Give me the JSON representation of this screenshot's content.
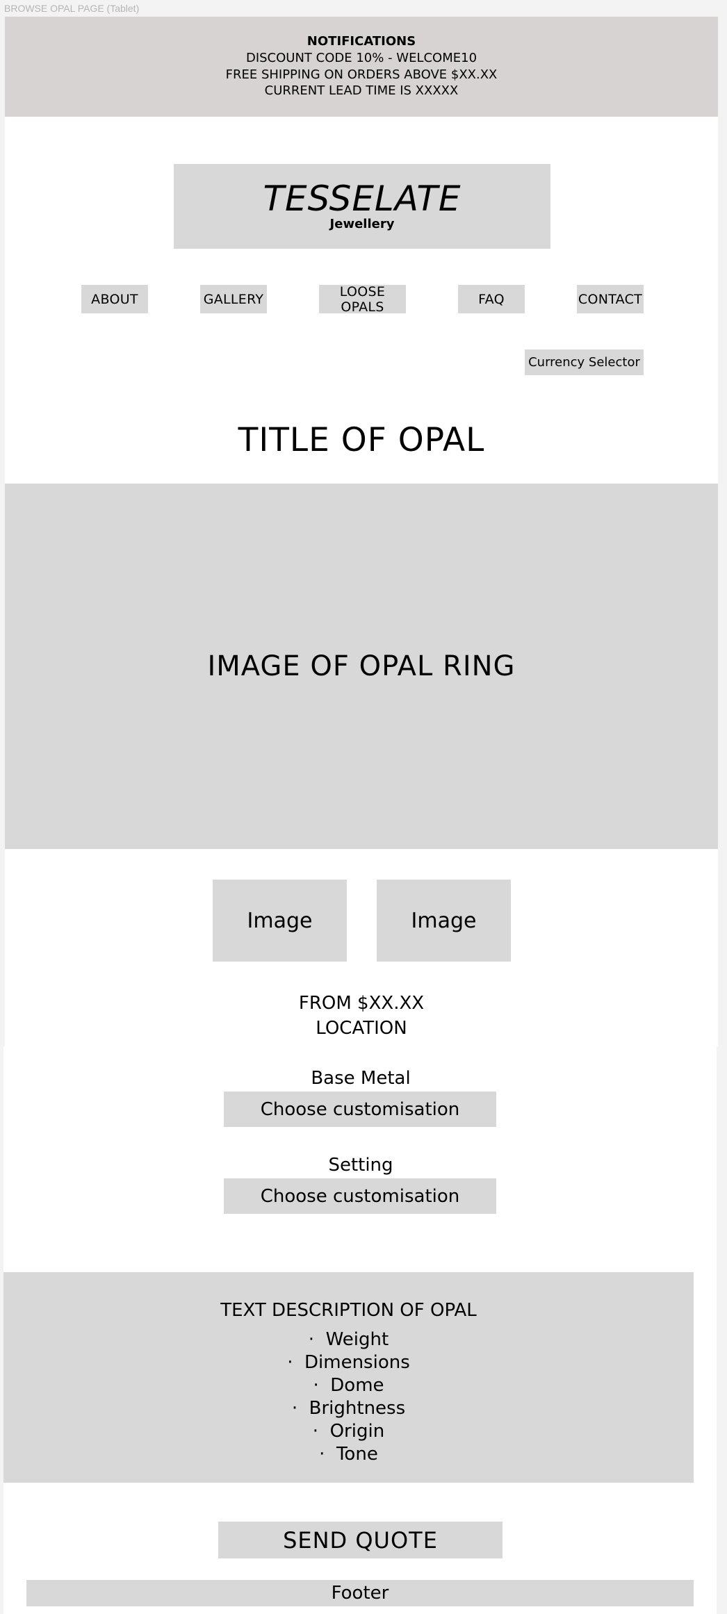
{
  "page_label": "BROWSE OPAL PAGE (Tablet)",
  "notifications": {
    "title": "NOTIFICATIONS",
    "lines": [
      "DISCOUNT CODE 10% - WELCOME10",
      "FREE SHIPPING ON ORDERS ABOVE $XX.XX",
      "CURRENT LEAD TIME IS XXXXX"
    ]
  },
  "logo": {
    "brand": "TESSELATE",
    "tagline": "Jewellery"
  },
  "nav": {
    "items": [
      "ABOUT",
      "GALLERY",
      "LOOSE OPALS",
      "FAQ",
      "CONTACT"
    ]
  },
  "currency_selector": "Currency Selector",
  "product": {
    "title": "TITLE OF OPAL",
    "main_image": "IMAGE OF OPAL RING",
    "thumbnails": [
      "Image",
      "Image"
    ],
    "price": "FROM $XX.XX",
    "location": "LOCATION"
  },
  "customisation": [
    {
      "label": "Base Metal",
      "value": "Choose customisation"
    },
    {
      "label": "Setting",
      "value": "Choose customisation"
    }
  ],
  "description": {
    "title": "TEXT DESCRIPTION OF OPAL",
    "bullet": "·",
    "items": [
      "Weight",
      "Dimensions",
      "Dome",
      "Brightness",
      "Origin",
      "Tone"
    ]
  },
  "send_quote": "SEND QUOTE",
  "footer": "Footer",
  "colors": {
    "placeholder_gray": "#d8d8d8",
    "notification_bg": "#d6d3d2",
    "page_bg": "#f3f3f3"
  }
}
